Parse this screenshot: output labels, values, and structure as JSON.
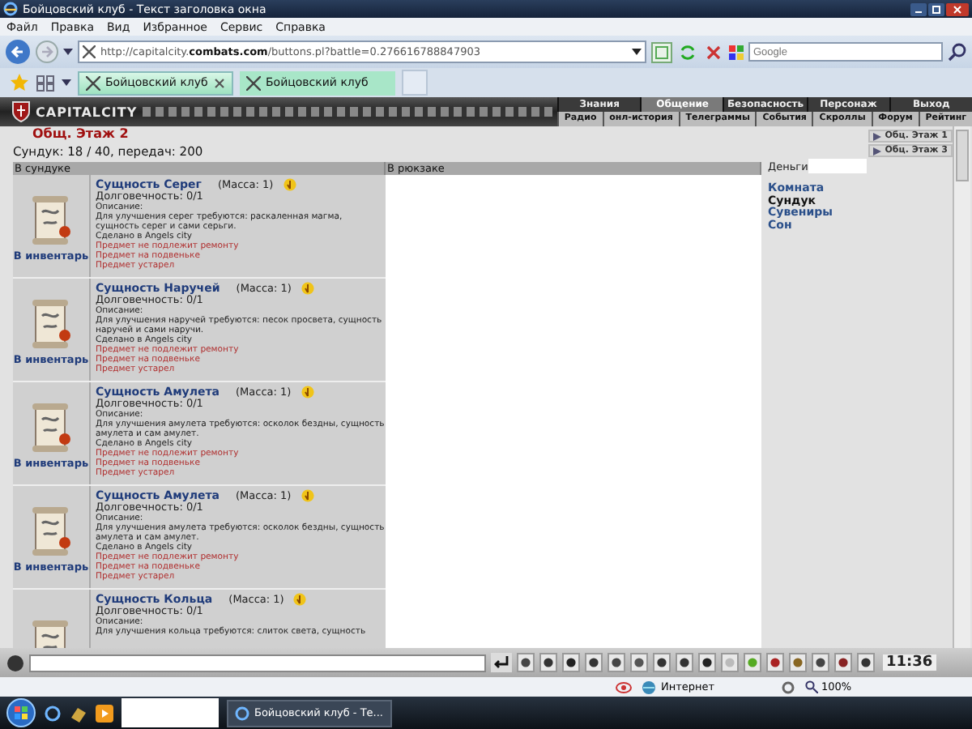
{
  "window": {
    "title": "Бойцовский клуб - Текст заголовка окна"
  },
  "menu": [
    "Файл",
    "Правка",
    "Вид",
    "Избранное",
    "Сервис",
    "Справка"
  ],
  "address": {
    "url": "http://capitalcity.**combats.com**/buttons.pl?battle=0.276616788847903"
  },
  "search": {
    "placeholder": "Google"
  },
  "tabs": [
    {
      "label": "Бойцовский клуб",
      "selected": true
    },
    {
      "label": "Бойцовский клуб",
      "selected": false
    }
  ],
  "game": {
    "logo": "CAPITALCITY",
    "nav": [
      {
        "label": "Знания",
        "selected": false
      },
      {
        "label": "Общение",
        "selected": true
      },
      {
        "label": "Безопасность",
        "selected": false
      },
      {
        "label": "Персонаж",
        "selected": false
      },
      {
        "label": "Выход",
        "selected": false
      }
    ],
    "subnav": [
      "Радио",
      "онл-история",
      "Телеграммы",
      "События",
      "Скроллы",
      "Форум",
      "Рейтинг"
    ]
  },
  "location": "Общ. Этаж 2",
  "chest_info": "Сундук: 18 / 40, передач: 200",
  "chest": {
    "heading": "В сундуке",
    "items": [
      {
        "name": "Сущность Серег",
        "mass": "(Масса: 1)",
        "durability": "Долговечность: 0/1",
        "desc_label": "Описание:",
        "desc": "Для улучшения серег требуются: раскаленная магма, сущность серег и сами серьги.",
        "made": "Сделано в Angels city",
        "notes": [
          "Предмет не подлежит ремонту",
          "Предмет на подвеньке",
          "Предмет устарел"
        ],
        "action": "В инвентарь"
      },
      {
        "name": "Сущность Наручей",
        "mass": "(Масса: 1)",
        "durability": "Долговечность: 0/1",
        "desc_label": "Описание:",
        "desc": "Для улучшения наручей требуются: песок просвета, сущность наручей и сами наручи.",
        "made": "Сделано в Angels city",
        "notes": [
          "Предмет не подлежит ремонту",
          "Предмет на подвеньке",
          "Предмет устарел"
        ],
        "action": "В инвентарь"
      },
      {
        "name": "Сущность Амулета",
        "mass": "(Масса: 1)",
        "durability": "Долговечность: 0/1",
        "desc_label": "Описание:",
        "desc": "Для улучшения амулета требуются: осколок бездны, сущность амулета и сам амулет.",
        "made": "Сделано в Angels city",
        "notes": [
          "Предмет не подлежит ремонту",
          "Предмет на подвеньке",
          "Предмет устарел"
        ],
        "action": "В инвентарь"
      },
      {
        "name": "Сущность Амулета",
        "mass": "(Масса: 1)",
        "durability": "Долговечность: 0/1",
        "desc_label": "Описание:",
        "desc": "Для улучшения амулета требуются: осколок бездны, сущность амулета и сам амулет.",
        "made": "Сделано в Angels city",
        "notes": [
          "Предмет не подлежит ремонту",
          "Предмет на подвеньке",
          "Предмет устарел"
        ],
        "action": "В инвентарь"
      },
      {
        "name": "Сущность Кольца",
        "mass": "(Масса: 1)",
        "durability": "Долговечность: 0/1",
        "desc_label": "Описание:",
        "desc": "Для улучшения кольца требуются: слиток света, сущность"
      }
    ]
  },
  "backpack": {
    "heading": "В рюкзаке"
  },
  "side": {
    "exits": [
      "Обц. Этаж 1",
      "Обц. Этаж 3"
    ],
    "money_label": "Деньги",
    "links": [
      {
        "label": "Комната",
        "selected": false
      },
      {
        "label": "Сундук",
        "selected": true
      },
      {
        "label": "Сувениры",
        "selected": false
      },
      {
        "label": "Сон",
        "selected": false
      }
    ]
  },
  "chat": {
    "clock": "11:36"
  },
  "status_bar": {
    "zone": "Интернет",
    "zoom": "100%"
  },
  "taskbar": {
    "window": "Бойцовский клуб - Те..."
  }
}
